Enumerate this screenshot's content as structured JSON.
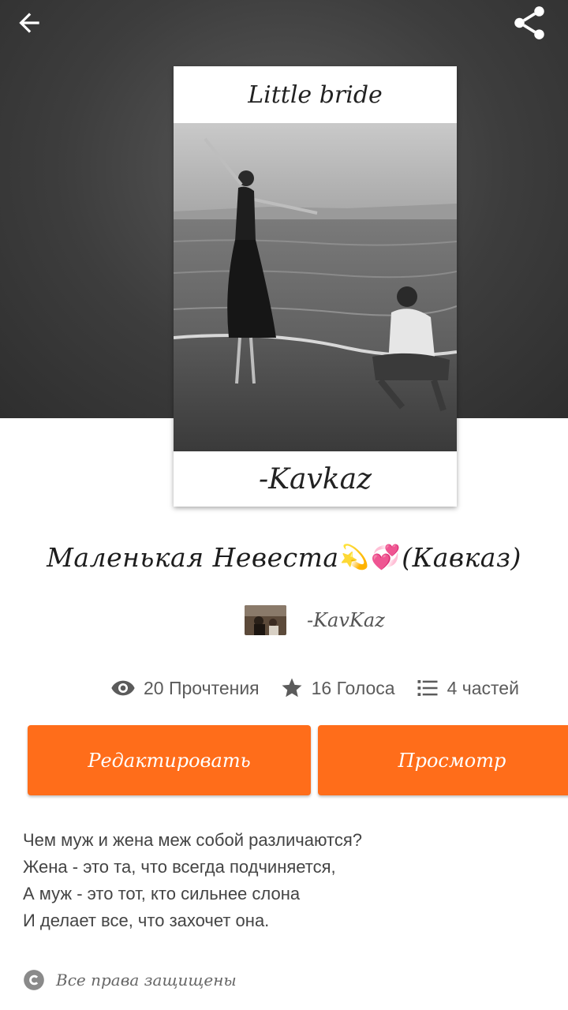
{
  "toolbar": {
    "back_icon": "arrow-left-icon",
    "share_icon": "share-icon"
  },
  "cover": {
    "top_text": "Little bride",
    "bottom_text": "-Kavkaz"
  },
  "story": {
    "title_part1": "Маленькая Невеста",
    "title_emoji1": "💫",
    "title_emoji2": "💞",
    "title_part2": "(Кавказ)",
    "author": "-KavKaz"
  },
  "stats": {
    "reads": "20 Прочтения",
    "votes": "16 Голоса",
    "parts": "4 частей"
  },
  "buttons": {
    "edit_label": "Редактировать",
    "view_label": "Просмотр"
  },
  "description": {
    "lines": [
      "Чем муж и жена меж собой различаются?",
      "Жена - это та, что всегда подчиняется,",
      "А муж - это тот, кто сильнее слона",
      "И делает все, что захочет она."
    ]
  },
  "copyright": {
    "label": "Все права защищены"
  },
  "colors": {
    "accent": "#ff6d1a",
    "hero_background": "#3d3d3d",
    "text_muted": "#5b5b5b"
  }
}
